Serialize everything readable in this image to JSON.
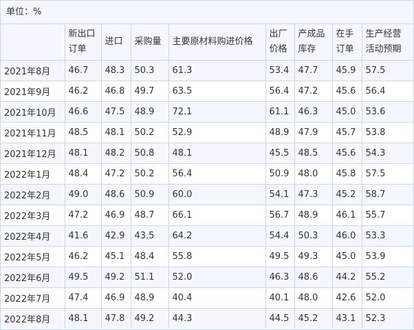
{
  "unit_label": "单位：%",
  "headers": [
    "",
    "新出口订单",
    "进口",
    "采购量",
    "主要原材料购进价格",
    "出厂价格",
    "产成品库存",
    "在手订单",
    "生产经营活动预期"
  ],
  "rows": [
    [
      "2021年8月",
      "46.7",
      "48.3",
      "50.3",
      "61.3",
      "53.4",
      "47.7",
      "45.9",
      "57.5"
    ],
    [
      "2021年9月",
      "46.2",
      "46.8",
      "49.7",
      "63.5",
      "56.4",
      "47.2",
      "45.6",
      "56.4"
    ],
    [
      "2021年10月",
      "46.6",
      "47.5",
      "48.9",
      "72.1",
      "61.1",
      "46.3",
      "45.0",
      "53.6"
    ],
    [
      "2021年11月",
      "48.5",
      "48.1",
      "50.2",
      "52.9",
      "48.9",
      "47.9",
      "45.7",
      "53.8"
    ],
    [
      "2021年12月",
      "48.1",
      "48.2",
      "50.8",
      "48.1",
      "45.5",
      "48.5",
      "45.6",
      "54.3"
    ],
    [
      "2022年1月",
      "48.4",
      "47.2",
      "50.2",
      "56.4",
      "50.9",
      "48.0",
      "45.8",
      "57.5"
    ],
    [
      "2022年2月",
      "49.0",
      "48.6",
      "50.9",
      "60.0",
      "54.1",
      "47.3",
      "45.2",
      "58.7"
    ],
    [
      "2022年3月",
      "47.2",
      "46.9",
      "48.7",
      "66.1",
      "56.7",
      "48.9",
      "46.1",
      "55.7"
    ],
    [
      "2022年4月",
      "41.6",
      "42.9",
      "43.5",
      "64.2",
      "54.4",
      "50.3",
      "46.0",
      "53.3"
    ],
    [
      "2022年5月",
      "46.2",
      "45.1",
      "48.4",
      "55.8",
      "49.5",
      "49.3",
      "45.0",
      "53.9"
    ],
    [
      "2022年6月",
      "49.5",
      "49.2",
      "51.1",
      "52.0",
      "46.3",
      "48.6",
      "44.2",
      "55.2"
    ],
    [
      "2022年7月",
      "47.4",
      "46.9",
      "48.9",
      "40.4",
      "40.1",
      "48.0",
      "42.6",
      "52.0"
    ],
    [
      "2022年8月",
      "48.1",
      "47.8",
      "49.2",
      "44.3",
      "44.5",
      "45.2",
      "43.1",
      "52.3"
    ]
  ],
  "colors": {
    "border": "#c9d6ea",
    "stripe": "#f4f7fd",
    "text": "#333333"
  }
}
